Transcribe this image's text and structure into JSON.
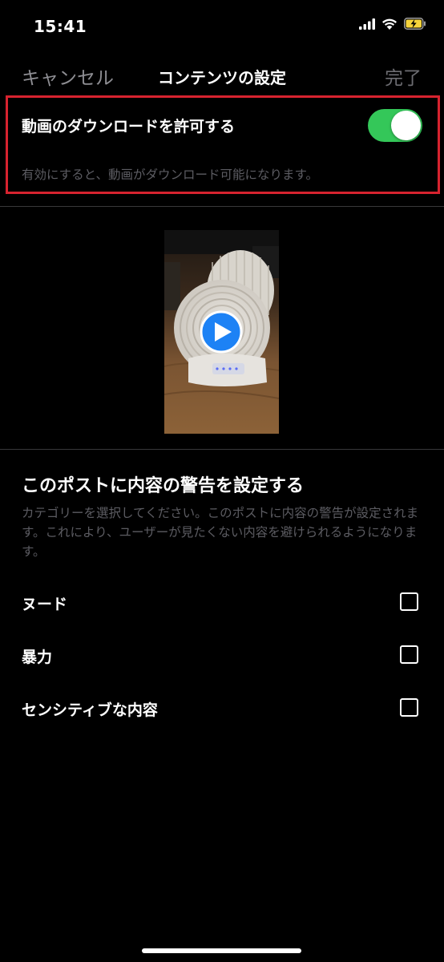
{
  "status_bar": {
    "time": "15:41",
    "icons": [
      "cellular-signal-icon",
      "wifi-icon",
      "battery-charging-icon"
    ]
  },
  "nav": {
    "cancel_label": "キャンセル",
    "title": "コンテンツの設定",
    "done_label": "完了"
  },
  "download_setting": {
    "title": "動画のダウンロードを許可する",
    "description": "有効にすると、動画がダウンロード可能になります。",
    "enabled": true
  },
  "preview": {
    "icon": "play-icon"
  },
  "content_warning": {
    "title": "このポストに内容の警告を設定する",
    "description": "カテゴリーを選択してください。このポストに内容の警告が設定されます。これにより、ユーザーが見たくない内容を避けられるようになります。",
    "options": [
      {
        "label": "ヌード",
        "checked": false
      },
      {
        "label": "暴力",
        "checked": false
      },
      {
        "label": "センシティブな内容",
        "checked": false
      }
    ]
  },
  "colors": {
    "background": "#000000",
    "toggle_on": "#34c759",
    "highlight_border": "#d7232f",
    "secondary_text": "#5c5c62",
    "play_button": "#1d82f5"
  }
}
